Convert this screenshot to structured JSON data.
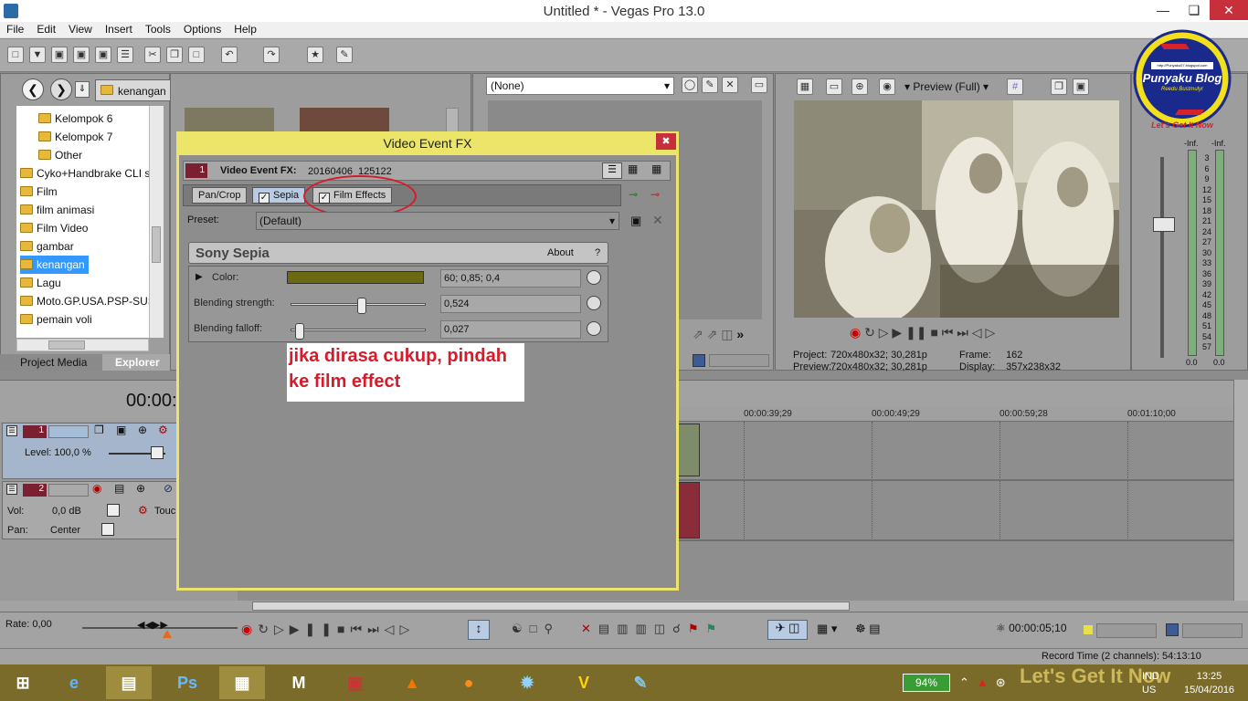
{
  "window": {
    "title": "Untitled * - Vegas Pro 13.0"
  },
  "menu": [
    "File",
    "Edit",
    "View",
    "Insert",
    "Tools",
    "Options",
    "Help"
  ],
  "explorer": {
    "path": "kenangan",
    "tree": [
      {
        "label": "Kelompok 6",
        "indent": true
      },
      {
        "label": "Kelompok 7",
        "indent": true
      },
      {
        "label": "Other",
        "indent": true
      },
      {
        "label": "Cyko+Handbrake CLI s",
        "indent": false
      },
      {
        "label": "Film",
        "indent": false
      },
      {
        "label": "film animasi",
        "indent": false
      },
      {
        "label": "Film Video",
        "indent": false
      },
      {
        "label": "gambar",
        "indent": false
      },
      {
        "label": "kenangan",
        "indent": false,
        "selected": true
      },
      {
        "label": "Lagu",
        "indent": false
      },
      {
        "label": "Moto.GP.USA.PSP-SUS",
        "indent": false
      },
      {
        "label": "pemain voli",
        "indent": false
      }
    ],
    "tabs": {
      "project_media": "Project Media",
      "explorer": "Explorer"
    }
  },
  "trimmer": {
    "select_value": "(None)"
  },
  "preview": {
    "mode": "Preview (Full)",
    "project_label": "Project:",
    "project_value": "720x480x32; 30,281p",
    "preview_label": "Preview:",
    "preview_value": "720x480x32; 30,281p",
    "frame_label": "Frame:",
    "frame_value": "162",
    "display_label": "Display:",
    "display_value": "357x238x32"
  },
  "meter": {
    "top_left": "-Inf.",
    "top_right": "-Inf.",
    "scale": [
      "3",
      "6",
      "9",
      "12",
      "15",
      "18",
      "21",
      "24",
      "27",
      "30",
      "33",
      "36",
      "39",
      "42",
      "45",
      "48",
      "51",
      "54",
      "57"
    ],
    "bottom_left": "0.0",
    "bottom_right": "0.0"
  },
  "logo": {
    "url": "http://Punyaku07.blogspot.com",
    "name": "Punyaku Blog",
    "by": "Reedu Bustmulyr",
    "slogan": "Let's Get It Now"
  },
  "timeline": {
    "time": "00:00:",
    "ruler": [
      "00:00:39;29",
      "00:00:49;29",
      "00:00:59;28",
      "00:01:10;00"
    ],
    "track1": {
      "num": "1",
      "level": "Level: 100,0 %"
    },
    "track2": {
      "num": "2",
      "vol_label": "Vol:",
      "vol_value": "0,0 dB",
      "pan_label": "Pan:",
      "pan_value": "Center",
      "touch": "Touc"
    },
    "rate": "Rate: 0,00",
    "position": "00:00:05;10",
    "record_time": "Record Time (2 channels): 54:13:10"
  },
  "dialog": {
    "title": "Video Event FX",
    "fx_label": "Video Event FX:",
    "fx_name": "20160406_125122",
    "track_num": "1",
    "chain": [
      {
        "label": "Pan/Crop",
        "checkbox": false
      },
      {
        "label": "Sepia",
        "checkbox": true
      },
      {
        "label": "Film Effects",
        "checkbox": true
      }
    ],
    "preset_label": "Preset:",
    "preset_value": "(Default)",
    "plugin_name": "Sony Sepia",
    "about": "About",
    "help": "?",
    "params": [
      {
        "label": "Color:",
        "value": "60; 0,85; 0,4",
        "level": null
      },
      {
        "label": "Blending strength:",
        "value": "0,524",
        "level": 0.524
      },
      {
        "label": "Blending falloff:",
        "value": "0,027",
        "level": 0.027
      }
    ],
    "color_swatch": "#6b6a12"
  },
  "annotation": {
    "line1": "jika dirasa cukup, pindah",
    "line2": "ke film effect"
  },
  "taskbar": {
    "battery": "94%",
    "lang1": "IND",
    "lang2": "US",
    "time": "13:25",
    "date": "15/04/2016",
    "watermark": "Let's Get It Now"
  }
}
